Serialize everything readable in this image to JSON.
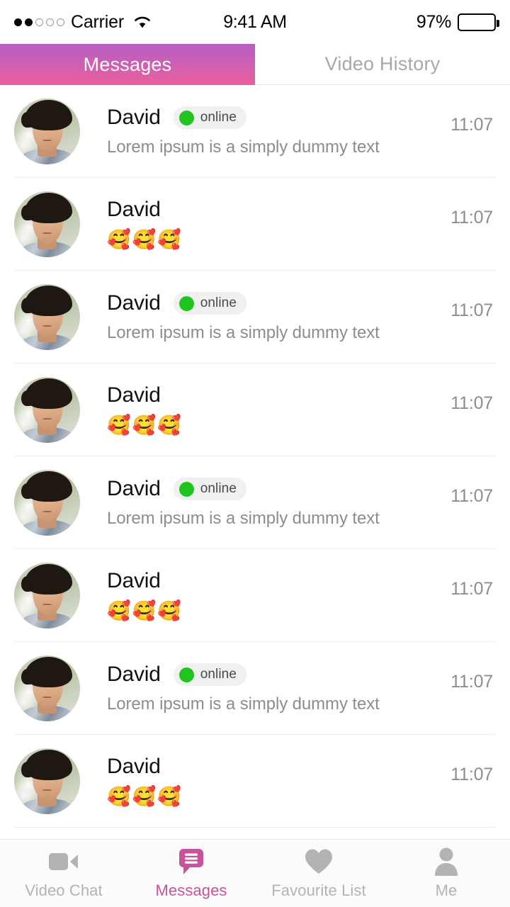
{
  "status_bar": {
    "signal_dots_filled": 2,
    "signal_dots_total": 5,
    "carrier": "Carrier",
    "wifi_icon": "wifi-icon",
    "time": "9:41 AM",
    "battery_percent": "97%",
    "battery_level": 97
  },
  "top_tabs": {
    "active_index": 0,
    "items": [
      {
        "label": "Messages",
        "active": true
      },
      {
        "label": "Video History",
        "active": false
      }
    ],
    "active_gradient_from": "#b55fc7",
    "active_gradient_to": "#e8609c",
    "inactive_color": "#a8a8a8"
  },
  "colors": {
    "accent_pink": "#c9529f",
    "online_green": "#1fc41f",
    "badge_bg": "#f0f0f0",
    "secondary_text": "#8d8d8d",
    "divider": "#ededed",
    "tab_inactive": "#b3b3b3"
  },
  "conversations": [
    {
      "name": "David",
      "online": true,
      "status_label": "online",
      "preview": "Lorem ipsum is a simply dummy text",
      "is_emoji": false,
      "time": "11:07",
      "avatar": "avatar-david"
    },
    {
      "name": "David",
      "online": false,
      "status_label": "",
      "preview": "🥰🥰🥰",
      "is_emoji": true,
      "time": "11:07",
      "avatar": "avatar-david"
    },
    {
      "name": "David",
      "online": true,
      "status_label": "online",
      "preview": "Lorem ipsum is a simply dummy text",
      "is_emoji": false,
      "time": "11:07",
      "avatar": "avatar-david"
    },
    {
      "name": "David",
      "online": false,
      "status_label": "",
      "preview": "🥰🥰🥰",
      "is_emoji": true,
      "time": "11:07",
      "avatar": "avatar-david"
    },
    {
      "name": "David",
      "online": true,
      "status_label": "online",
      "preview": "Lorem ipsum is a simply dummy text",
      "is_emoji": false,
      "time": "11:07",
      "avatar": "avatar-david"
    },
    {
      "name": "David",
      "online": false,
      "status_label": "",
      "preview": "🥰🥰🥰",
      "is_emoji": true,
      "time": "11:07",
      "avatar": "avatar-david"
    },
    {
      "name": "David",
      "online": true,
      "status_label": "online",
      "preview": "Lorem ipsum is a simply dummy text",
      "is_emoji": false,
      "time": "11:07",
      "avatar": "avatar-david"
    },
    {
      "name": "David",
      "online": false,
      "status_label": "",
      "preview": "🥰🥰🥰",
      "is_emoji": true,
      "time": "11:07",
      "avatar": "avatar-david"
    }
  ],
  "bottom_tabs": {
    "active_index": 1,
    "items": [
      {
        "label": "Video Chat",
        "icon": "video-camera-icon",
        "active": false
      },
      {
        "label": "Messages",
        "icon": "speech-bubble-icon",
        "active": true
      },
      {
        "label": "Favourite List",
        "icon": "heart-icon",
        "active": false
      },
      {
        "label": "Me",
        "icon": "person-icon",
        "active": false
      }
    ]
  }
}
